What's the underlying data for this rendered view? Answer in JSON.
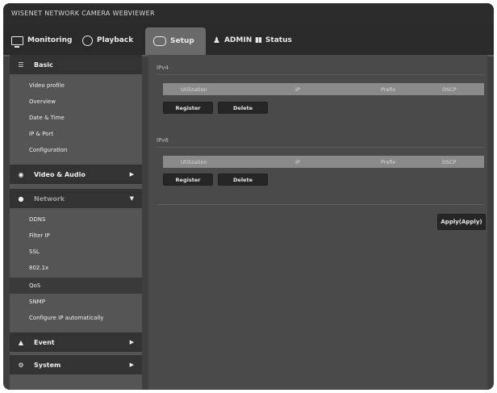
{
  "app": {
    "brand": "WISENET NETWORK CAMERA WEBVIEWER"
  },
  "nav": {
    "monitoring": "Monitoring",
    "playback": "Playback",
    "setup": "Setup",
    "user": "ADMIN",
    "status": "Status"
  },
  "sidebar": {
    "basic": {
      "label": "Basic",
      "items": [
        "Video profile",
        "Overview",
        "Date & Time",
        "IP & Port",
        "Configuration"
      ]
    },
    "video_audio": {
      "label": "Video & Audio"
    },
    "network": {
      "label": "Network",
      "items": [
        "DDNS",
        "Filter IP",
        "SSL",
        "802.1x",
        "QoS",
        "SNMP",
        "Configure IP automatically"
      ],
      "active_index": 4
    },
    "event": {
      "label": "Event"
    },
    "system": {
      "label": "System"
    }
  },
  "main": {
    "ipv4": {
      "title": "IPv4",
      "columns": [
        "Utilization",
        "IP",
        "Prefix",
        "DSCP"
      ],
      "add_label": "Register",
      "delete_label": "Delete"
    },
    "ipv6": {
      "title": "IPv6",
      "columns": [
        "Utilization",
        "IP",
        "Prefix",
        "DSCP"
      ],
      "add_label": "Register",
      "delete_label": "Delete"
    },
    "apply_label": "Apply(Apply)"
  }
}
